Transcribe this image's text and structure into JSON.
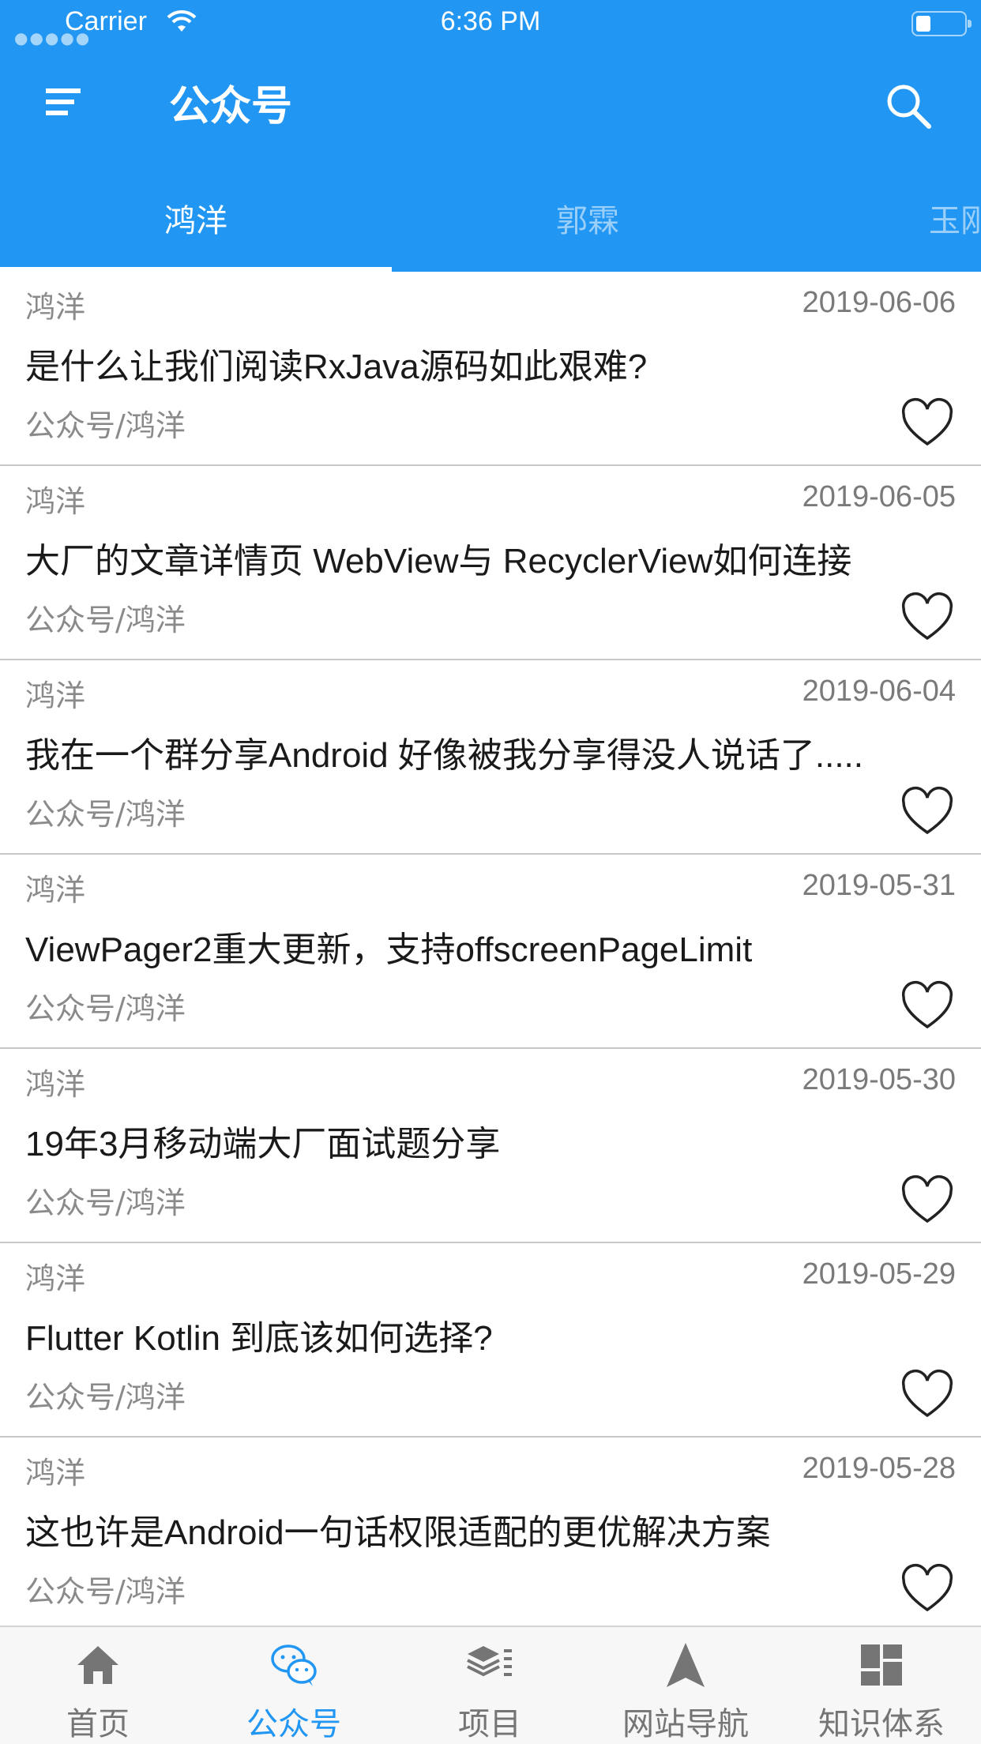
{
  "status_bar": {
    "carrier": "Carrier",
    "time": "6:36 PM"
  },
  "app_bar": {
    "title": "公众号",
    "menu_icon": "menu-icon",
    "search_icon": "search-icon"
  },
  "tabs": [
    {
      "label": "鸿洋",
      "active": true
    },
    {
      "label": "郭霖",
      "active": false
    },
    {
      "label": "玉刚说",
      "active": false
    }
  ],
  "articles": [
    {
      "author": "鸿洋",
      "date": "2019-06-06",
      "title": "是什么让我们阅读RxJava源码如此艰难?",
      "chapter": "公众号/鸿洋"
    },
    {
      "author": "鸿洋",
      "date": "2019-06-05",
      "title": "大厂的文章详情页 WebView与 RecyclerView如何连接",
      "chapter": "公众号/鸿洋"
    },
    {
      "author": "鸿洋",
      "date": "2019-06-04",
      "title": "我在一个群分享Android 好像被我分享得没人说话了.....",
      "chapter": "公众号/鸿洋"
    },
    {
      "author": "鸿洋",
      "date": "2019-05-31",
      "title": "ViewPager2重大更新，支持offscreenPageLimit",
      "chapter": "公众号/鸿洋"
    },
    {
      "author": "鸿洋",
      "date": "2019-05-30",
      "title": "19年3月移动端大厂面试题分享",
      "chapter": "公众号/鸿洋"
    },
    {
      "author": "鸿洋",
      "date": "2019-05-29",
      "title": "Flutter Kotlin 到底该如何选择?",
      "chapter": "公众号/鸿洋"
    },
    {
      "author": "鸿洋",
      "date": "2019-05-28",
      "title": "这也许是Android一句话权限适配的更优解决方案",
      "chapter": "公众号/鸿洋"
    }
  ],
  "bottom_nav": [
    {
      "label": "首页",
      "icon": "home-icon",
      "active": false
    },
    {
      "label": "公众号",
      "icon": "wechat-icon",
      "active": true
    },
    {
      "label": "项目",
      "icon": "layers-icon",
      "active": false
    },
    {
      "label": "网站导航",
      "icon": "navigation-icon",
      "active": false
    },
    {
      "label": "知识体系",
      "icon": "dashboard-icon",
      "active": false
    }
  ],
  "colors": {
    "primary": "#2196f3",
    "text": "#1a1a1a",
    "secondary_text": "#8a8a8a",
    "inactive_nav": "#757575"
  }
}
